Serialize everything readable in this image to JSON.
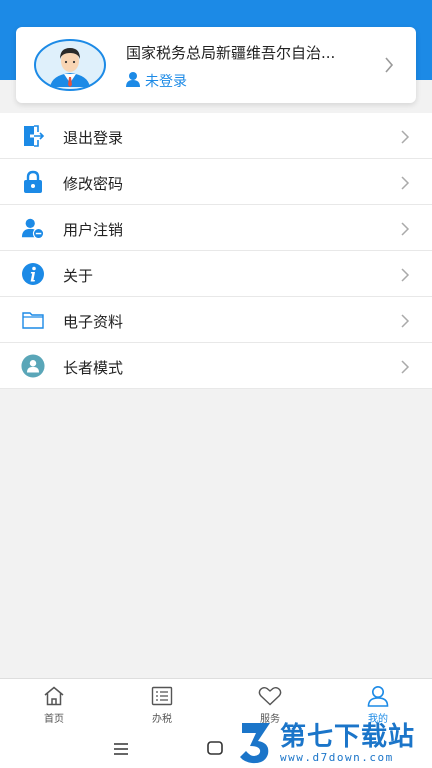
{
  "profile": {
    "name": "国家税务总局新疆维吾尔自治...",
    "login_status": "未登录"
  },
  "menu": {
    "items": [
      {
        "label": "退出登录",
        "icon": "logout-icon"
      },
      {
        "label": "修改密码",
        "icon": "lock-icon"
      },
      {
        "label": "用户注销",
        "icon": "user-remove-icon"
      },
      {
        "label": "关于",
        "icon": "info-icon"
      },
      {
        "label": "电子资料",
        "icon": "folder-icon"
      },
      {
        "label": "长者模式",
        "icon": "elder-mode-icon"
      }
    ]
  },
  "tabs": [
    {
      "label": "首页",
      "icon": "home-icon"
    },
    {
      "label": "办税",
      "icon": "list-icon"
    },
    {
      "label": "服务",
      "icon": "heart-icon"
    },
    {
      "label": "我的",
      "icon": "person-icon",
      "active": true
    }
  ],
  "watermark": {
    "title": "第七下载站",
    "url": "www.d7down.com"
  },
  "colors": {
    "accent": "#1c8ae6",
    "background": "#f2f2f2"
  }
}
